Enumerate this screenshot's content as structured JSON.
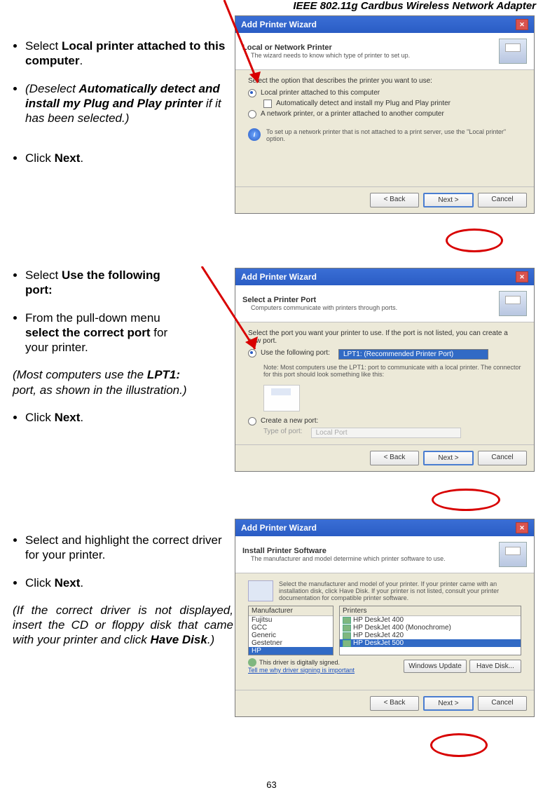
{
  "header": "IEEE 802.11g Cardbus Wireless Network Adapter",
  "page_number": "63",
  "instructions": {
    "block1": {
      "b1_pre": "Select ",
      "b1_bold": "Local printer attached to this computer",
      "b1_post": ".",
      "b2_pre": "(Deselect ",
      "b2_bold": "Automatically detect and install my Plug and Play printer",
      "b2_post": " if it has been selected.)",
      "b3_pre": "Click ",
      "b3_bold": "Next",
      "b3_post": "."
    },
    "block2": {
      "b1_pre": "Select ",
      "b1_bold": "Use the following port:",
      "b2_pre": "From the pull-down menu ",
      "b2_bold": "select the correct port",
      "b2_post": " for your printer.",
      "note_pre": "(Most computers use the ",
      "note_bold": "LPT1:",
      "note_post": " port, as shown in the illustration.)",
      "b3_pre": "Click ",
      "b3_bold": "Next",
      "b3_post": "."
    },
    "block3": {
      "b1": "Select and highlight the correct driver for your printer.",
      "b2_pre": "Click ",
      "b2_bold": "Next",
      "b2_post": ".",
      "note_pre": "(If the correct driver is not displayed, insert the CD or floppy disk that came with your printer and click ",
      "note_bold": "Have Disk",
      "note_post": ".)"
    }
  },
  "wizard1": {
    "title": "Add Printer Wizard",
    "heading": "Local or Network Printer",
    "sub": "The wizard needs to know which type of printer to set up.",
    "prompt": "Select the option that describes the printer you want to use:",
    "opt1": "Local printer attached to this computer",
    "chk": "Automatically detect and install my Plug and Play printer",
    "opt2": "A network printer, or a printer attached to another computer",
    "info": "To set up a network printer that is not attached to a print server, use the \"Local printer\" option.",
    "back": "< Back",
    "next": "Next >",
    "cancel": "Cancel"
  },
  "wizard2": {
    "title": "Add Printer Wizard",
    "heading": "Select a Printer Port",
    "sub": "Computers communicate with printers through ports.",
    "prompt": "Select the port you want your printer to use. If the port is not listed, you can create a new port.",
    "opt1": "Use the following port:",
    "port": "LPT1: (Recommended Printer Port)",
    "note": "Note: Most computers use the LPT1: port to communicate with a local printer. The connector for this port should look something like this:",
    "opt2": "Create a new port:",
    "type_label": "Type of port:",
    "type_val": "Local Port",
    "back": "< Back",
    "next": "Next >",
    "cancel": "Cancel"
  },
  "wizard3": {
    "title": "Add Printer Wizard",
    "heading": "Install Printer Software",
    "sub": "The manufacturer and model determine which printer software to use.",
    "prompt": "Select the manufacturer and model of your printer. If your printer came with an installation disk, click Have Disk. If your printer is not listed, consult your printer documentation for compatible printer software.",
    "mfr_hdr": "Manufacturer",
    "prt_hdr": "Printers",
    "mfrs": [
      "Fujitsu",
      "GCC",
      "Generic",
      "Gestetner",
      "HP"
    ],
    "prts": [
      "HP DeskJet 400",
      "HP DeskJet 400 (Monochrome)",
      "HP DeskJet 420",
      "HP DeskJet 500"
    ],
    "signed": "This driver is digitally signed.",
    "tell": "Tell me why driver signing is important",
    "winupd": "Windows Update",
    "havedisk": "Have Disk...",
    "back": "< Back",
    "next": "Next >",
    "cancel": "Cancel"
  }
}
